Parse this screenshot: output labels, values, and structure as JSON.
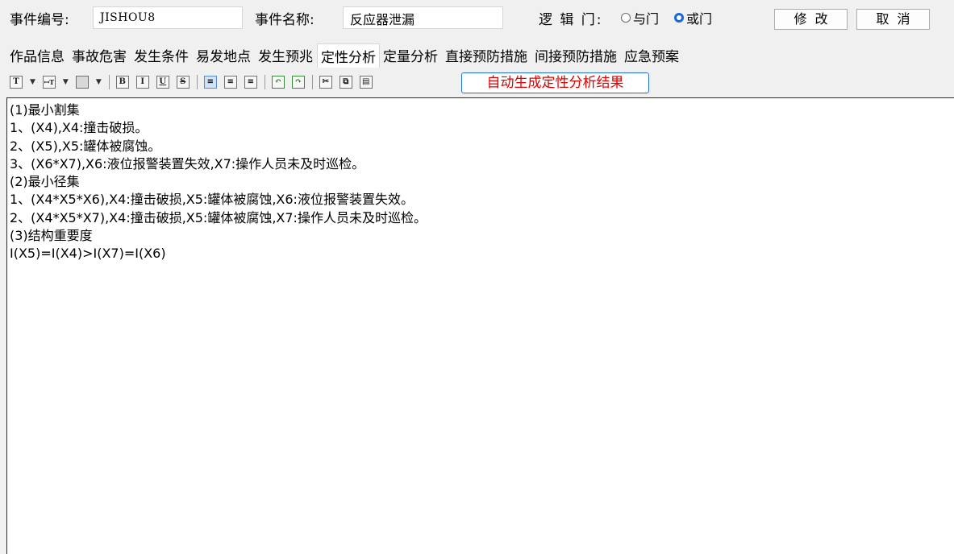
{
  "header": {
    "event_id_label": "事件编号:",
    "event_id_value": "JISHOU8",
    "event_name_label": "事件名称:",
    "event_name_value": "反应器泄漏",
    "logic_gate_label": "逻 辑 门:",
    "gate_and_label": "与门",
    "gate_or_label": "或门",
    "selected_gate": "或门",
    "modify_button": "修改",
    "cancel_button": "取消"
  },
  "tabs": [
    {
      "label": "作品信息",
      "active": false
    },
    {
      "label": "事故危害",
      "active": false
    },
    {
      "label": "发生条件",
      "active": false
    },
    {
      "label": "易发地点",
      "active": false
    },
    {
      "label": "发生预兆",
      "active": false
    },
    {
      "label": "定性分析",
      "active": true
    },
    {
      "label": "定量分析",
      "active": false
    },
    {
      "label": "直接预防措施",
      "active": false
    },
    {
      "label": "间接预防措施",
      "active": false
    },
    {
      "label": "应急预案",
      "active": false
    }
  ],
  "toolbar": {
    "auto_generate_button": "自动生成定性分析结果",
    "accent_color": "#1f6fd0",
    "button_text_color": "#e00000"
  },
  "editor": {
    "lines": [
      "(1)最小割集",
      "1、(X4),X4:撞击破损。",
      "2、(X5),X5:罐体被腐蚀。",
      "3、(X6*X7),X6:液位报警装置失效,X7:操作人员未及时巡检。",
      "(2)最小径集",
      "1、(X4*X5*X6),X4:撞击破损,X5:罐体被腐蚀,X6:液位报警装置失效。",
      "2、(X4*X5*X7),X4:撞击破损,X5:罐体被腐蚀,X7:操作人员未及时巡检。",
      "(3)结构重要度",
      "I(X5)=I(X4)>I(X7)=I(X6)"
    ]
  }
}
